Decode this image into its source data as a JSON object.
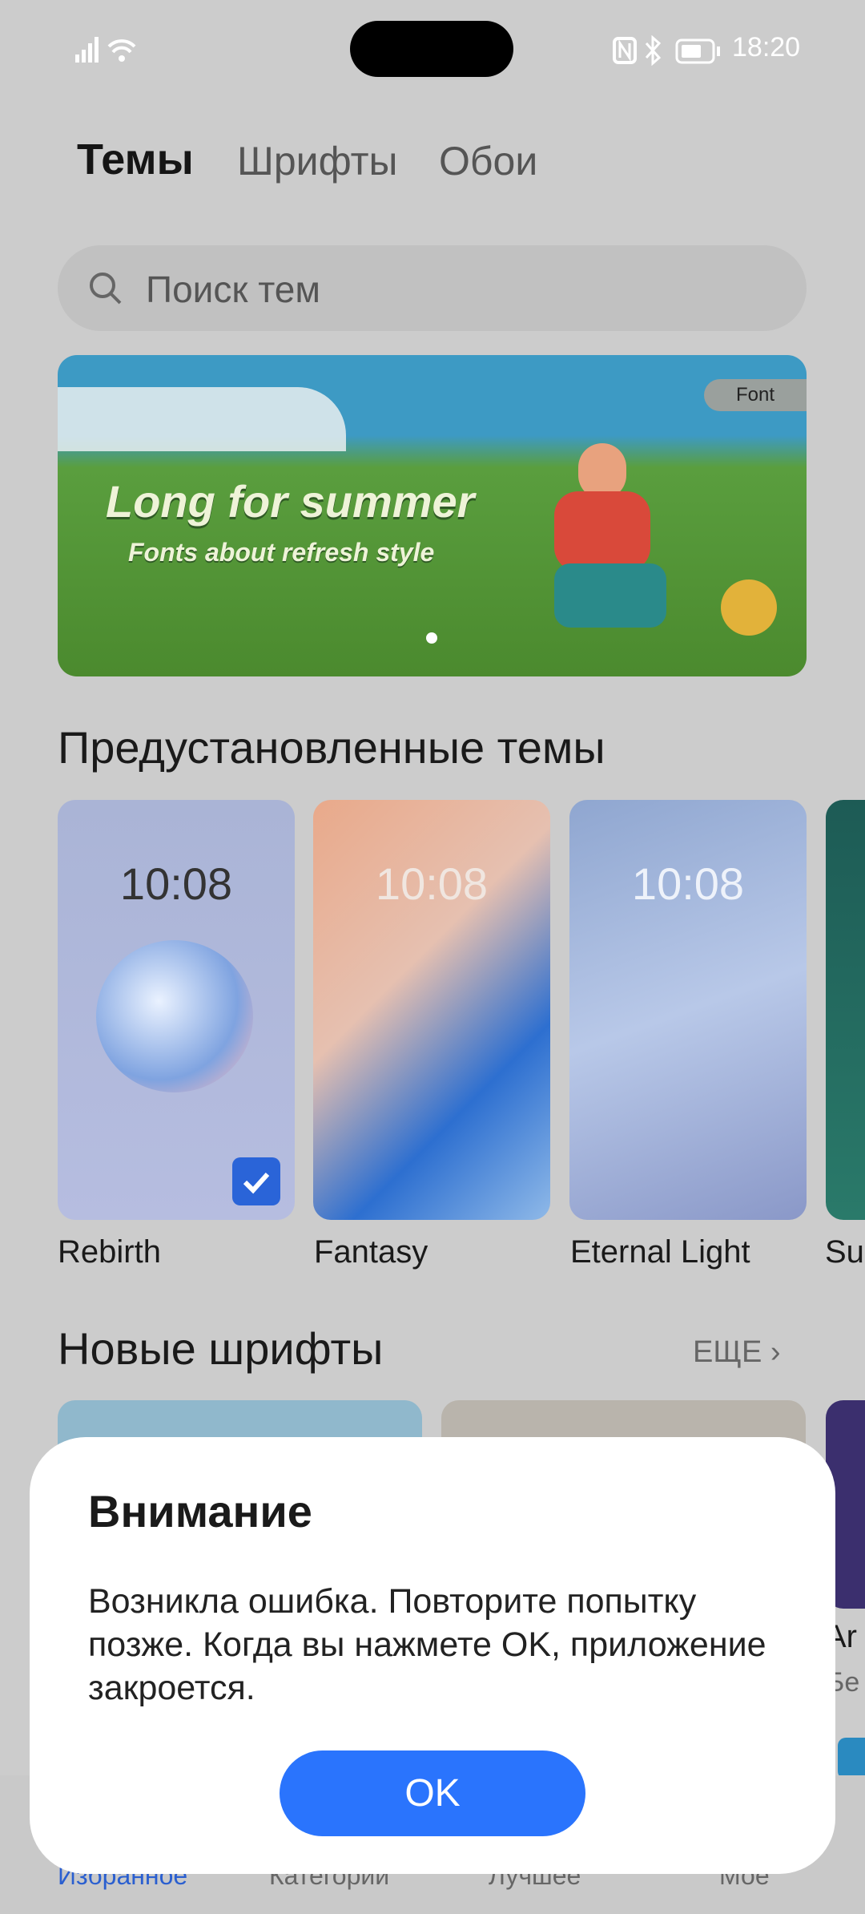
{
  "status_bar": {
    "time": "18:20",
    "icons": [
      "signal-icon",
      "wifi-icon",
      "nfc-icon",
      "bluetooth-icon",
      "battery-icon"
    ]
  },
  "tabs": [
    {
      "label": "Темы",
      "active": true
    },
    {
      "label": "Шрифты"
    },
    {
      "label": "Обои"
    }
  ],
  "search": {
    "placeholder": "Поиск тем"
  },
  "banner": {
    "title": "Long for summer",
    "subtitle": "Fonts about refresh style",
    "badge": "Font"
  },
  "preinstalled": {
    "title": "Предустановленные темы",
    "items": [
      {
        "name": "Rebirth",
        "clock": "10:08",
        "selected": true
      },
      {
        "name": "Fantasy",
        "clock": "10:08"
      },
      {
        "name": "Eternal Light",
        "clock": "10:08"
      },
      {
        "name": "Su"
      }
    ]
  },
  "new_fonts": {
    "title": "Новые шрифты",
    "more": "ЕЩЕ",
    "partial_name": "Ar",
    "partial_sub": "Бе"
  },
  "dialog": {
    "title": "Внимание",
    "message": "Возникла ошибка. Повторите попытку позже. Когда вы нажмете OK, приложение закроется.",
    "ok_label": "OK"
  },
  "bottom_nav": [
    {
      "label": "Избранное",
      "active": true
    },
    {
      "label": "Категории"
    },
    {
      "label": "Лучшее"
    },
    {
      "label": "Мое"
    }
  ],
  "colors": {
    "accent": "#2a74fd",
    "selected_check": "#2a64d8"
  }
}
